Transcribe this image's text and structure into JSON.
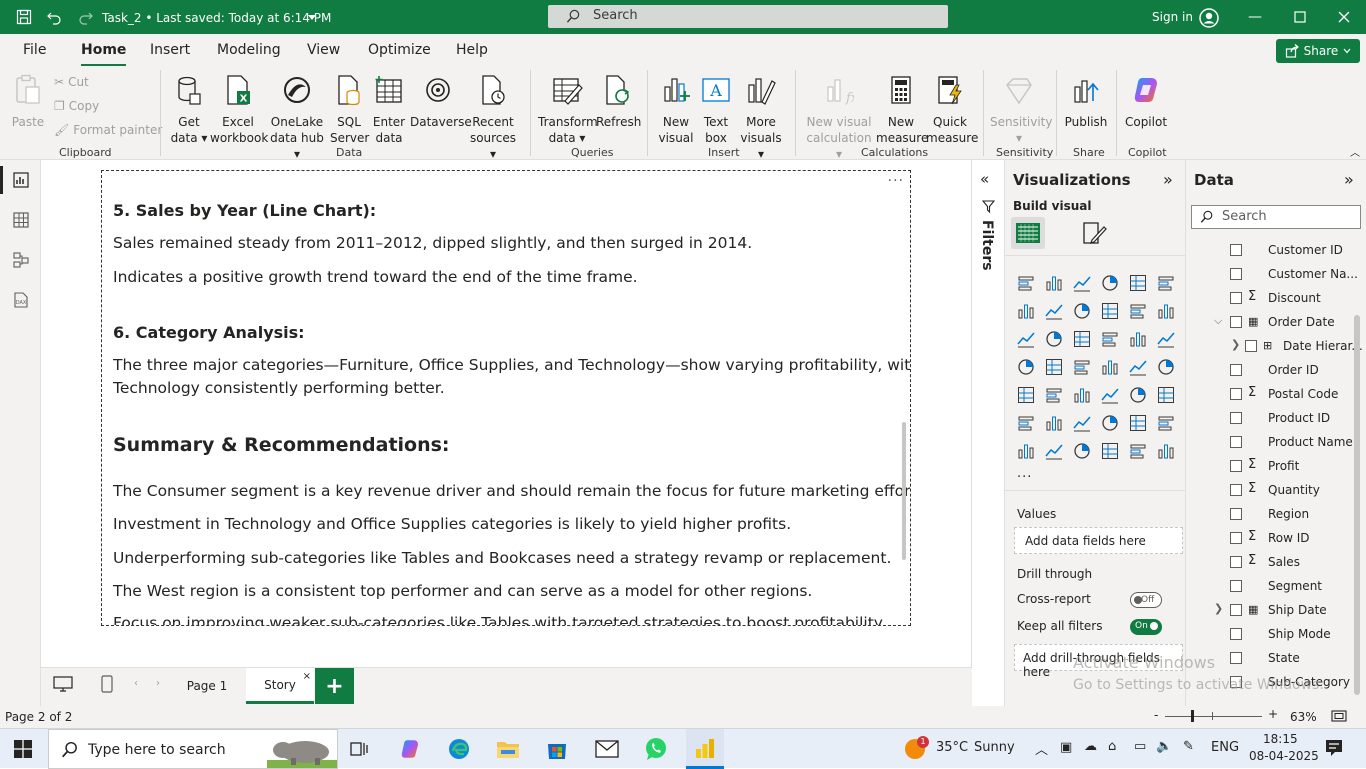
{
  "titlebar": {
    "title": "Task_2 • Last saved: Today at 6:14 PM",
    "search_placeholder": "Search",
    "signin_label": "Sign in"
  },
  "menu": {
    "tabs": [
      "File",
      "Home",
      "Insert",
      "Modeling",
      "View",
      "Optimize",
      "Help"
    ],
    "active_tab": "Home",
    "share_label": "Share"
  },
  "ribbon": {
    "clipboard": {
      "paste": "Paste",
      "cut": "Cut",
      "copy": "Copy",
      "format_painter": "Format painter",
      "label": "Clipboard"
    },
    "data": {
      "get_data": [
        "Get",
        "data"
      ],
      "excel": [
        "Excel",
        "workbook"
      ],
      "onelake": [
        "OneLake",
        "data hub"
      ],
      "sql": [
        "SQL",
        "Server"
      ],
      "enter_data": [
        "Enter",
        "data"
      ],
      "dataverse": "Dataverse",
      "recent": [
        "Recent",
        "sources"
      ],
      "label": "Data"
    },
    "queries": {
      "transform": [
        "Transform",
        "data"
      ],
      "refresh": "Refresh",
      "label": "Queries"
    },
    "insert": {
      "new_visual": [
        "New",
        "visual"
      ],
      "text_box": [
        "Text",
        "box"
      ],
      "more_visuals": [
        "More",
        "visuals"
      ],
      "label": "Insert"
    },
    "calculations": {
      "new_visual_calc": [
        "New visual",
        "calculation"
      ],
      "new_measure": [
        "New",
        "measure"
      ],
      "quick_measure": [
        "Quick",
        "measure"
      ],
      "label": "Calculations"
    },
    "sensitivity": {
      "sensitivity": "Sensitivity",
      "label": "Sensitivity"
    },
    "share": {
      "publish": "Publish",
      "label": "Share"
    },
    "copilot": {
      "copilot": "Copilot",
      "label": "Copilot"
    }
  },
  "textbox": {
    "h5": "5. Sales by Year (Line Chart):",
    "p5a": "Sales remained steady from 2011–2012, dipped slightly, and then surged in 2014.",
    "p5b": "Indicates a positive growth trend toward the end of the time frame.",
    "h6": "6. Category Analysis:",
    "p6a": "The three major categories—Furniture, Office Supplies, and Technology—show varying profitability, with",
    "p6b": "Technology consistently performing better.",
    "hs": "Summary & Recommendations:",
    "r1": "The Consumer segment is a key revenue driver and should remain the focus for future marketing efforts.",
    "r2": "Investment in Technology and Office Supplies categories is likely to yield higher profits.",
    "r3": "Underperforming sub-categories like Tables and Bookcases need a strategy revamp or replacement.",
    "r4": "The West region is a consistent top performer and can serve as a model for other regions.",
    "r5": "Focus on improving weaker sub-categories like Tables with targeted strategies to boost profitability."
  },
  "filters": {
    "label": "Filters"
  },
  "viz": {
    "title": "Visualizations",
    "build_visual": "Build visual",
    "values_label": "Values",
    "values_placeholder": "Add data fields here",
    "drill_through": "Drill through",
    "cross_report": "Cross-report",
    "cross_report_state": "Off",
    "keep_all_filters": "Keep all filters",
    "keep_all_filters_state": "On",
    "drill_placeholder": "Add drill-through fields here",
    "more": "..."
  },
  "data_pane": {
    "title": "Data",
    "search_placeholder": "Search",
    "fields": [
      {
        "label": "Customer ID",
        "sigma": false
      },
      {
        "label": "Customer Na...",
        "sigma": false
      },
      {
        "label": "Discount",
        "sigma": true
      },
      {
        "label": "Order Date",
        "sigma": false,
        "expanded": true,
        "calendar": true
      },
      {
        "label": "Date Hierar...",
        "sigma": false,
        "child": true
      },
      {
        "label": "Order ID",
        "sigma": false
      },
      {
        "label": "Postal Code",
        "sigma": true
      },
      {
        "label": "Product ID",
        "sigma": false
      },
      {
        "label": "Product Name",
        "sigma": false
      },
      {
        "label": "Profit",
        "sigma": true
      },
      {
        "label": "Quantity",
        "sigma": true
      },
      {
        "label": "Region",
        "sigma": false
      },
      {
        "label": "Row ID",
        "sigma": true
      },
      {
        "label": "Sales",
        "sigma": true
      },
      {
        "label": "Segment",
        "sigma": false
      },
      {
        "label": "Ship Date",
        "sigma": false,
        "collapsed": true,
        "calendar": true
      },
      {
        "label": "Ship Mode",
        "sigma": false
      },
      {
        "label": "State",
        "sigma": false
      },
      {
        "label": "Sub-Category",
        "sigma": false
      }
    ]
  },
  "pages": {
    "tabs": [
      "Page 1",
      "Story"
    ],
    "active": "Story",
    "add": "+"
  },
  "status": {
    "page_indicator": "Page 2 of 2",
    "zoom": "63%",
    "zoom_level": 0.63
  },
  "watermark": {
    "line1": "Activate Windows",
    "line2": "Go to Settings to activate Windows."
  },
  "taskbar": {
    "search_placeholder": "Type here to search",
    "weather_temp": "35°C",
    "weather_desc": "Sunny",
    "weather_badge": "1",
    "language": "ENG",
    "time": "18:15",
    "date": "08-04-2025"
  },
  "colors": {
    "accent": "#107c41",
    "panel_bg": "#f3f2f1",
    "taskbar_bg": "#e8eef7"
  }
}
